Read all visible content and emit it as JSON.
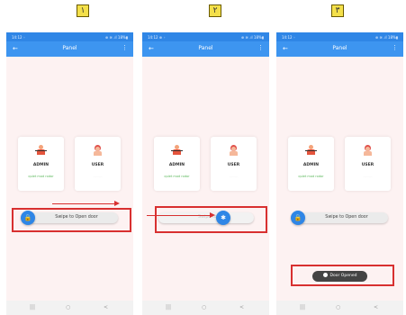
{
  "steps": [
    {
      "badge": "١",
      "time": "14:12 ◦",
      "signal": "⊕ ≋ .ıl 18%▮"
    },
    {
      "badge": "٢",
      "time": "14:12 ⊕ ◦",
      "signal": "⊕ ≋ .ıl 18%▮"
    },
    {
      "badge": "٣",
      "time": "14:12 ◦",
      "signal": "⊕ ≋ .ıl 18%▮"
    }
  ],
  "appbar": {
    "title": "Panel",
    "back_icon": "←",
    "menu_icon": "⋮"
  },
  "cards": {
    "admin": {
      "name": "ADMIN",
      "sub": "quiet mod rodor"
    },
    "user": {
      "name": "USER",
      "sub": "--------"
    }
  },
  "swipe": {
    "label": "Swipe to Open door",
    "label_partial": "Swipe to Ope"
  },
  "toast": {
    "label": "Door Opened"
  },
  "navbar": {
    "recent": "|||",
    "home": "○",
    "back": "<"
  },
  "colors": {
    "primary": "#3d95f0",
    "highlight": "#d83030",
    "badge": "#f4e04a"
  }
}
